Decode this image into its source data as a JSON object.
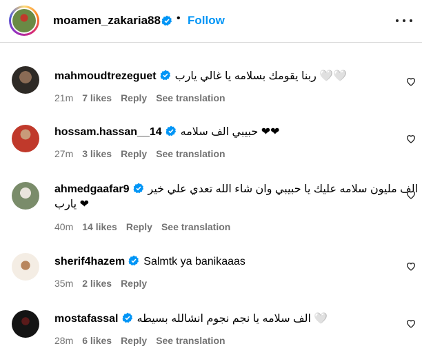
{
  "header": {
    "username": "moamen_zakaria88",
    "separator": "•",
    "follow_label": "Follow",
    "verified_color": "#0095f6"
  },
  "comments": [
    {
      "username": "mahmoudtrezeguet",
      "verified": true,
      "text": "ربنا يقومك بسلامه يا غالي يارب 🤍🤍",
      "time": "21m",
      "likes": "7 likes",
      "reply": "Reply",
      "translation": "See translation",
      "avatar_color": "#4a3f35"
    },
    {
      "username": "hossam.hassan__14",
      "verified": true,
      "text": "حبيبي الف سلامه ❤❤",
      "time": "27m",
      "likes": "3 likes",
      "reply": "Reply",
      "translation": "See translation",
      "avatar_color": "#c0392b"
    },
    {
      "username": "ahmedgaafar9",
      "verified": true,
      "text": "الف مليون سلامه عليك يا حبيبي وان شاء الله تعدي علي خير",
      "text_line2": "يارب ❤",
      "time": "40m",
      "likes": "14 likes",
      "reply": "Reply",
      "translation": "See translation",
      "avatar_color": "#7a8c6a"
    },
    {
      "username": "sherif4hazem",
      "verified": true,
      "text": "Salmtk ya banikaaas",
      "time": "35m",
      "likes": "2 likes",
      "reply": "Reply",
      "avatar_color": "#e3d4c2"
    },
    {
      "username": "mostafassal",
      "verified": true,
      "text": "الف سلامه يا نجم نجوم انشالله بسيطه 🤍",
      "time": "28m",
      "likes": "6 likes",
      "reply": "Reply",
      "translation": "See translation",
      "avatar_color": "#1a1a1a"
    }
  ],
  "icons": {
    "verified": "verified-badge-icon",
    "heart": "heart-outline-icon",
    "more": "more-options-icon"
  }
}
